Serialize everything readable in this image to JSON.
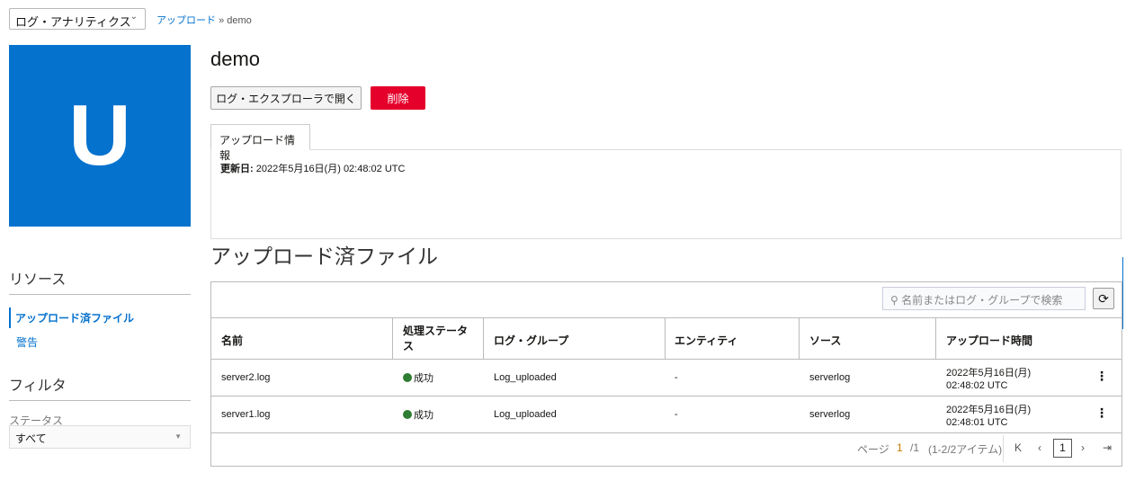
{
  "header": {
    "service_select": "ログ・アナリティクス",
    "breadcrumb_link": "アップロード",
    "breadcrumb_sep": "»",
    "breadcrumb_current": "demo"
  },
  "logo": {
    "letter": "U",
    "color": "#0572ce"
  },
  "page": {
    "title": "demo",
    "open_button": "ログ・エクスプローラで開く",
    "delete_button": "削除",
    "tab": "アップロード情報",
    "updated_label": "更新日:",
    "updated_value": "2022年5月16日(月) 02:48:02 UTC"
  },
  "sidebar": {
    "resources_heading": "リソース",
    "items": [
      {
        "label": "アップロード済ファイル",
        "active": true
      },
      {
        "label": "警告",
        "active": false
      }
    ],
    "filter_heading": "フィルタ",
    "status_label": "ステータス",
    "status_value": "すべて"
  },
  "files": {
    "heading": "アップロード済ファイル",
    "search_placeholder": "名前またはログ・グループで検索",
    "columns": [
      "名前",
      "処理ステータス",
      "ログ・グループ",
      "エンティティ",
      "ソース",
      "アップロード時間"
    ],
    "rows": [
      {
        "name": "server2.log",
        "status": "成功",
        "log_group": "Log_uploaded",
        "entity": "-",
        "source": "serverlog",
        "date": "2022年5月16日(月)",
        "time": "02:48:02 UTC"
      },
      {
        "name": "server1.log",
        "status": "成功",
        "log_group": "Log_uploaded",
        "entity": "-",
        "source": "serverlog",
        "date": "2022年5月16日(月)",
        "time": "02:48:01 UTC"
      }
    ],
    "status_color": "#2e7d32",
    "pagination": {
      "page_label": "ページ",
      "page": "1",
      "total": "/1",
      "range": "(1-2/2アイテム)",
      "current": "1"
    }
  }
}
